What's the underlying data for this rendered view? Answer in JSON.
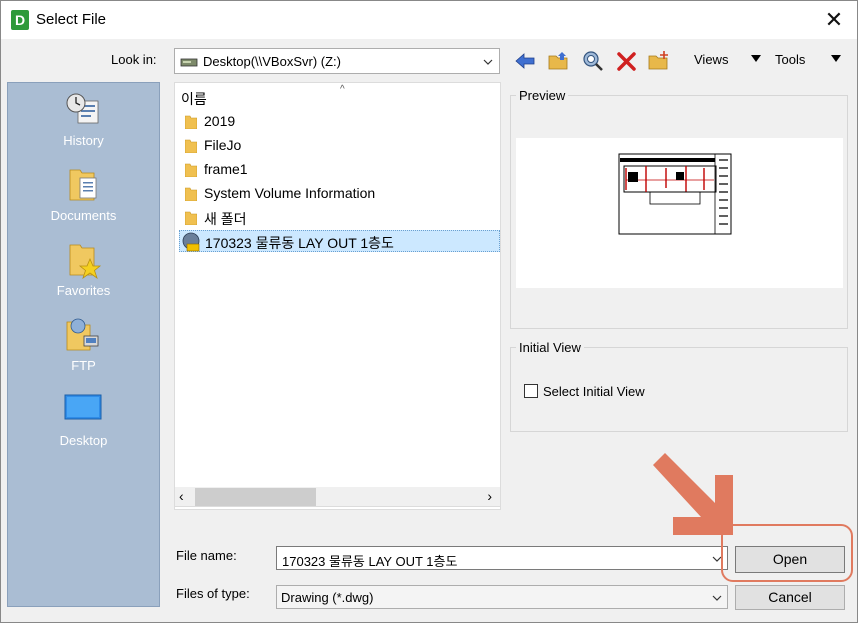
{
  "window": {
    "title": "Select File",
    "app_letter": "D"
  },
  "toolbar": {
    "look_in_label": "Look in:",
    "look_in_value": "Desktop(\\\\VBoxSvr) (Z:)",
    "views_label": "Views",
    "tools_label": "Tools"
  },
  "places": [
    {
      "label": "History",
      "icon": "history-icon"
    },
    {
      "label": "Documents",
      "icon": "documents-icon"
    },
    {
      "label": "Favorites",
      "icon": "favorites-icon"
    },
    {
      "label": "FTP",
      "icon": "ftp-icon"
    },
    {
      "label": "Desktop",
      "icon": "desktop-icon"
    }
  ],
  "file_list": {
    "column_header": "이름",
    "items": [
      {
        "name": "2019",
        "type": "folder"
      },
      {
        "name": "FileJo",
        "type": "folder"
      },
      {
        "name": "frame1",
        "type": "folder"
      },
      {
        "name": "System Volume Information",
        "type": "folder"
      },
      {
        "name": "새 폴더",
        "type": "folder"
      },
      {
        "name": "170323 물류동 LAY OUT 1층도",
        "type": "dwg",
        "selected": true
      }
    ]
  },
  "preview": {
    "label": "Preview"
  },
  "initial_view": {
    "label": "Initial View",
    "checkbox_label": "Select Initial View",
    "checked": false
  },
  "file_name": {
    "label": "File name:",
    "value": "170323 물류동 LAY OUT 1층도"
  },
  "files_of_type": {
    "label": "Files of type:",
    "value": "Drawing (*.dwg)"
  },
  "buttons": {
    "open": "Open",
    "cancel": "Cancel"
  },
  "colors": {
    "places_bg": "#aabdd3",
    "selection": "#cce8ff",
    "annotation": "#e07a5f"
  }
}
